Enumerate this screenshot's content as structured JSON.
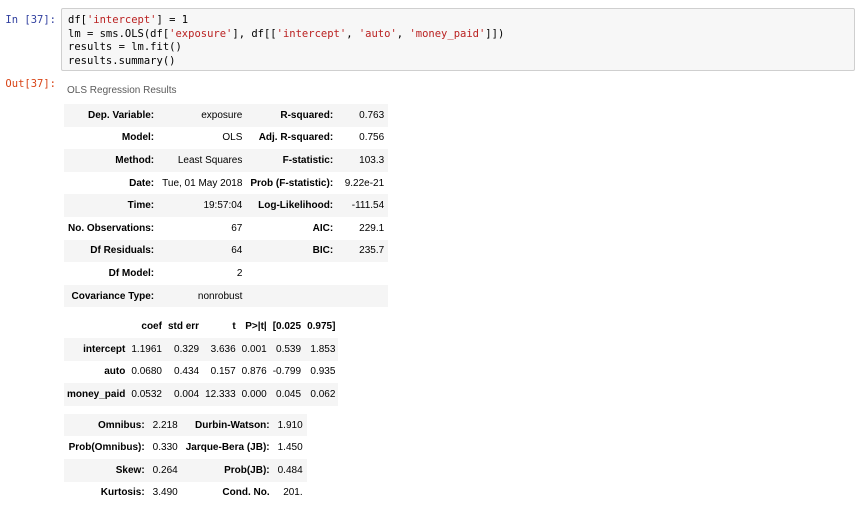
{
  "cell": {
    "in_prompt": "In [37]:",
    "out_prompt": "Out[37]:",
    "code_lines": [
      "df['intercept'] = 1",
      "lm = sms.OLS(df['exposure'], df[['intercept', 'auto', 'money_paid']])",
      "results = lm.fit()",
      "results.summary()"
    ]
  },
  "summary": {
    "caption": "OLS Regression Results",
    "top_table": [
      [
        "Dep. Variable:",
        "exposure",
        "R-squared:",
        "0.763"
      ],
      [
        "Model:",
        "OLS",
        "Adj. R-squared:",
        "0.756"
      ],
      [
        "Method:",
        "Least Squares",
        "F-statistic:",
        "103.3"
      ],
      [
        "Date:",
        "Tue, 01 May 2018",
        "Prob (F-statistic):",
        "9.22e-21"
      ],
      [
        "Time:",
        "19:57:04",
        "Log-Likelihood:",
        "-111.54"
      ],
      [
        "No. Observations:",
        "67",
        "AIC:",
        "229.1"
      ],
      [
        "Df Residuals:",
        "64",
        "BIC:",
        "235.7"
      ],
      [
        "Df Model:",
        "2",
        "",
        ""
      ],
      [
        "Covariance Type:",
        "nonrobust",
        "",
        ""
      ]
    ],
    "coef_header": [
      "",
      "coef",
      "std err",
      "t",
      "P>|t|",
      "[0.025",
      "0.975]"
    ],
    "coef_rows": [
      [
        "intercept",
        "1.1961",
        "0.329",
        "3.636",
        "0.001",
        "0.539",
        "1.853"
      ],
      [
        "auto",
        "0.0680",
        "0.434",
        "0.157",
        "0.876",
        "-0.799",
        "0.935"
      ],
      [
        "money_paid",
        "0.0532",
        "0.004",
        "12.333",
        "0.000",
        "0.045",
        "0.062"
      ]
    ],
    "diag_table": [
      [
        "Omnibus:",
        "2.218",
        "Durbin-Watson:",
        "1.910"
      ],
      [
        "Prob(Omnibus):",
        "0.330",
        "Jarque-Bera (JB):",
        "1.450"
      ],
      [
        "Skew:",
        "0.264",
        "Prob(JB):",
        "0.484"
      ],
      [
        "Kurtosis:",
        "3.490",
        "Cond. No.",
        "201."
      ]
    ]
  }
}
